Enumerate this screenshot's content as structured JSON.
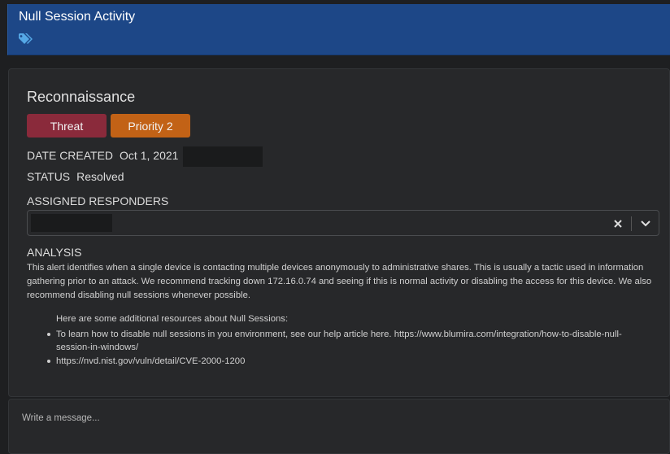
{
  "header": {
    "title": "Null Session Activity",
    "tag_icon": "tags-icon",
    "color": "#1d4787"
  },
  "alert": {
    "section_title": "Reconnaissance",
    "badges": [
      {
        "label": "Threat",
        "color": "#8a2a3b"
      },
      {
        "label": "Priority 2",
        "color": "#c26216"
      }
    ],
    "date_created_label": "DATE CREATED",
    "date_created_value": "Oct 1, 2021",
    "status_label": "STATUS",
    "status_value": "Resolved",
    "assigned_label": "ASSIGNED RESPONDERS",
    "analysis_label": "ANALYSIS",
    "analysis_text": "This alert identifies when a single device is contacting multiple devices anonymously to administrative shares. This is usually a tactic used in information gathering prior to an attack. We recommend tracking down 172.16.0.74 and seeing if this is normal activity or disabling the access for this device. We also recommend disabling null sessions whenever possible.",
    "resources_intro": "Here are some additional resources about Null Sessions:",
    "resources": [
      "To learn how to disable null sessions in you environment, see our help article here. https://www.blumira.com/integration/how-to-disable-null-session-in-windows/",
      "https://nvd.nist.gov/vuln/detail/CVE-2000-1200"
    ]
  },
  "message": {
    "placeholder": "Write a message..."
  }
}
